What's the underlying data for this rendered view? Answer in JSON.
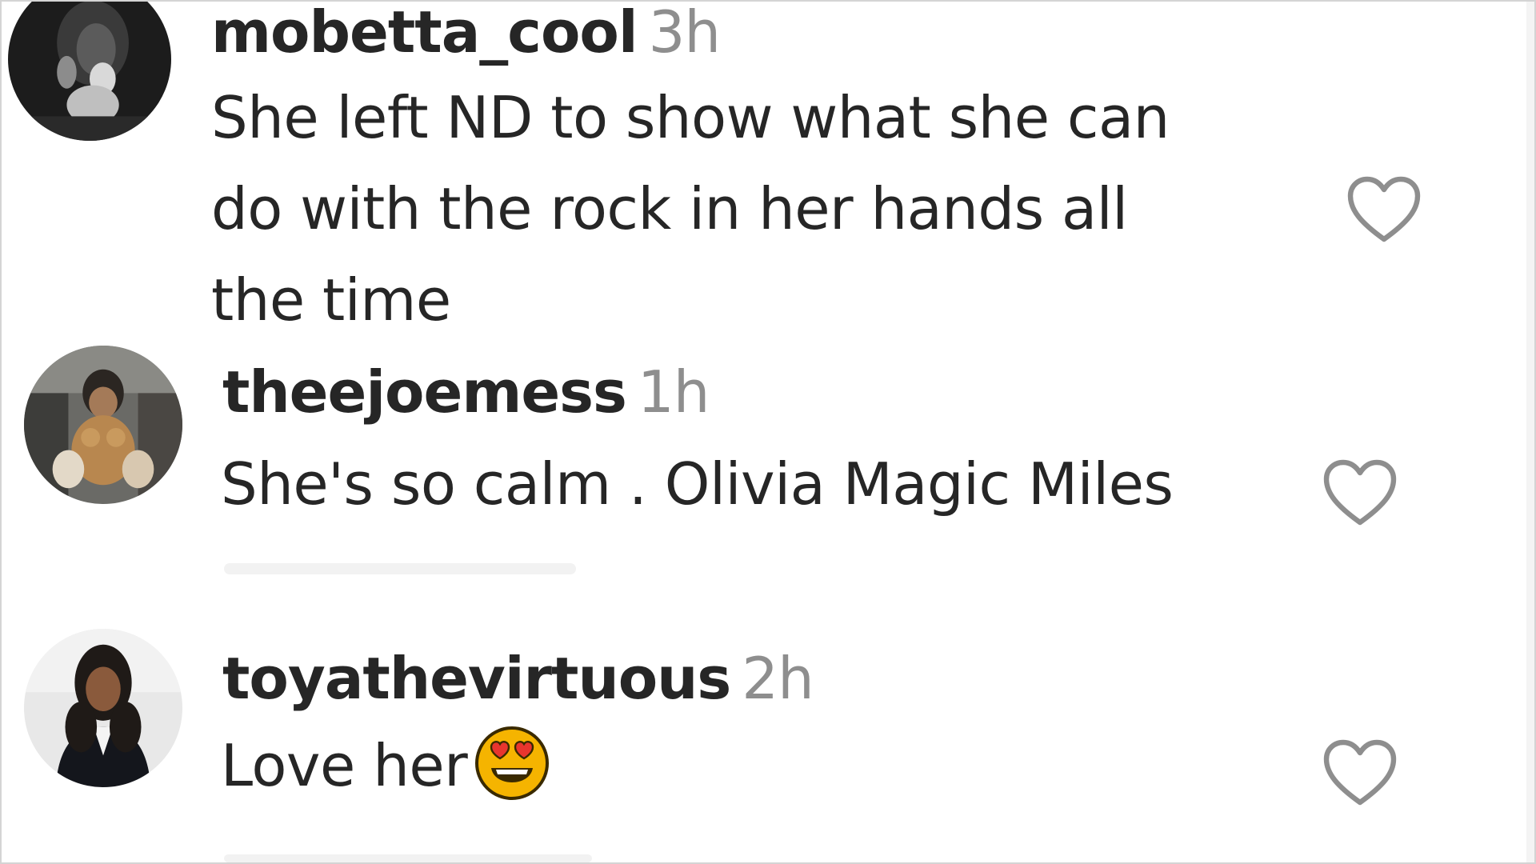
{
  "comments": [
    {
      "username": "mobetta_cool",
      "time": "3h",
      "text_lines": [
        "She left ND to show what she can",
        "do with the rock in her hands all",
        "the time"
      ],
      "avatar_icon": "avatar-bw-photo",
      "like_icon": "heart-outline-icon"
    },
    {
      "username": "theejoemess",
      "time": "1h",
      "text_lines": [
        "She's so calm . Olivia Magic Miles"
      ],
      "avatar_icon": "avatar-photo",
      "like_icon": "heart-outline-icon"
    },
    {
      "username": "toyathevirtuous",
      "time": "2h",
      "text_lines": [
        "Love her"
      ],
      "emoji": "heart-eyes-emoji",
      "avatar_icon": "avatar-photo",
      "like_icon": "heart-outline-icon"
    }
  ],
  "colors": {
    "username": "#262626",
    "timestamp": "#8e8e8e",
    "text": "#262626",
    "heart_stroke": "#8e8e8e",
    "emoji_face": "#f5b400",
    "emoji_hearts": "#e8352e"
  }
}
